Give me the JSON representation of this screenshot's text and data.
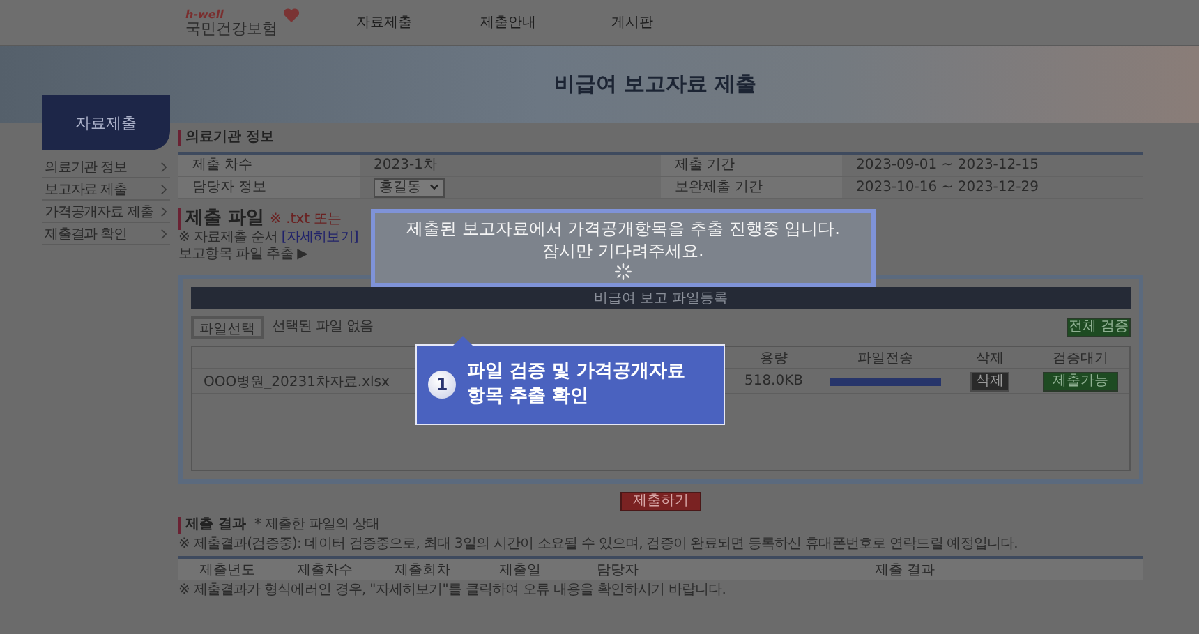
{
  "header": {
    "logo_tagline": "h-well",
    "logo_name": "국민건강보험",
    "nav": [
      "자료제출",
      "제출안내",
      "게시판"
    ]
  },
  "banner": {
    "title": "비급여 보고자료 제출"
  },
  "sidebar": {
    "title": "자료제출",
    "items": [
      {
        "label": "의료기관 정보",
        "selected": false
      },
      {
        "label": "보고자료 제출",
        "selected": false
      },
      {
        "label": "가격공개자료 제출",
        "selected": false
      },
      {
        "label": "제출결과 확인",
        "selected": false
      }
    ]
  },
  "institution": {
    "title": "의료기관 정보",
    "fields": [
      {
        "label": "제출 차수",
        "value": "2023-1차",
        "kind": "text"
      },
      {
        "label": "제출 기간",
        "value": "2023-09-01 ~ 2023-12-15",
        "kind": "text"
      },
      {
        "label": "담당자 정보",
        "value": "홍길동",
        "kind": "select"
      },
      {
        "label": "보완제출 기간",
        "value": "2023-10-16 ~ 2023-12-29",
        "kind": "text"
      }
    ]
  },
  "submit_file": {
    "title": "제출 파일",
    "note": "※ .txt 또는",
    "order_label": "※ 자료제출 순서",
    "order_link": "[자세히보기]",
    "steps": "보고항목 파일 추출 ▶",
    "panel_title": "비급여 보고 파일등록",
    "choose_button": "파일선택",
    "no_file": "선택된 파일 없음",
    "verify_all_button": "전체 검증",
    "columns": [
      "용량",
      "파일전송",
      "삭제",
      "검증대기"
    ],
    "files": [
      {
        "name": "OOO병원_20231차자료.xlsx",
        "size": "518.0KB",
        "level": 1,
        "delete_button": "삭제",
        "status_button": "제출가능"
      }
    ],
    "submit_button": "제출하기"
  },
  "results": {
    "title": "제출 결과",
    "subtitle": "* 제출한 파일의 상태",
    "notice": "※ 제출결과(검증중): 데이터 검증중으로, 최대 3일의 시간이 소요될 수 있으며, 검증이 완료되면 등록하신 휴대폰번호로 연락드릴 예정입니다.",
    "columns": [
      "제출년도",
      "제출차수",
      "제출회차",
      "제출일",
      "담당자",
      "제출 결과"
    ],
    "notice_2": "※ 제출결과가 형식에러인 경우, \"자세히보기\"를 클릭하여 오류 내용을 확인하시기 바랍니다."
  },
  "modal": {
    "lines": [
      "제출된 보고자료에서 가격공개항목을 추출 진행중 입니다.",
      "잠시만 기다려주세요."
    ]
  },
  "callout": {
    "step": "1",
    "lines": [
      "파일 검증 및 가격공개자료",
      "항목 추출 확인"
    ]
  }
}
